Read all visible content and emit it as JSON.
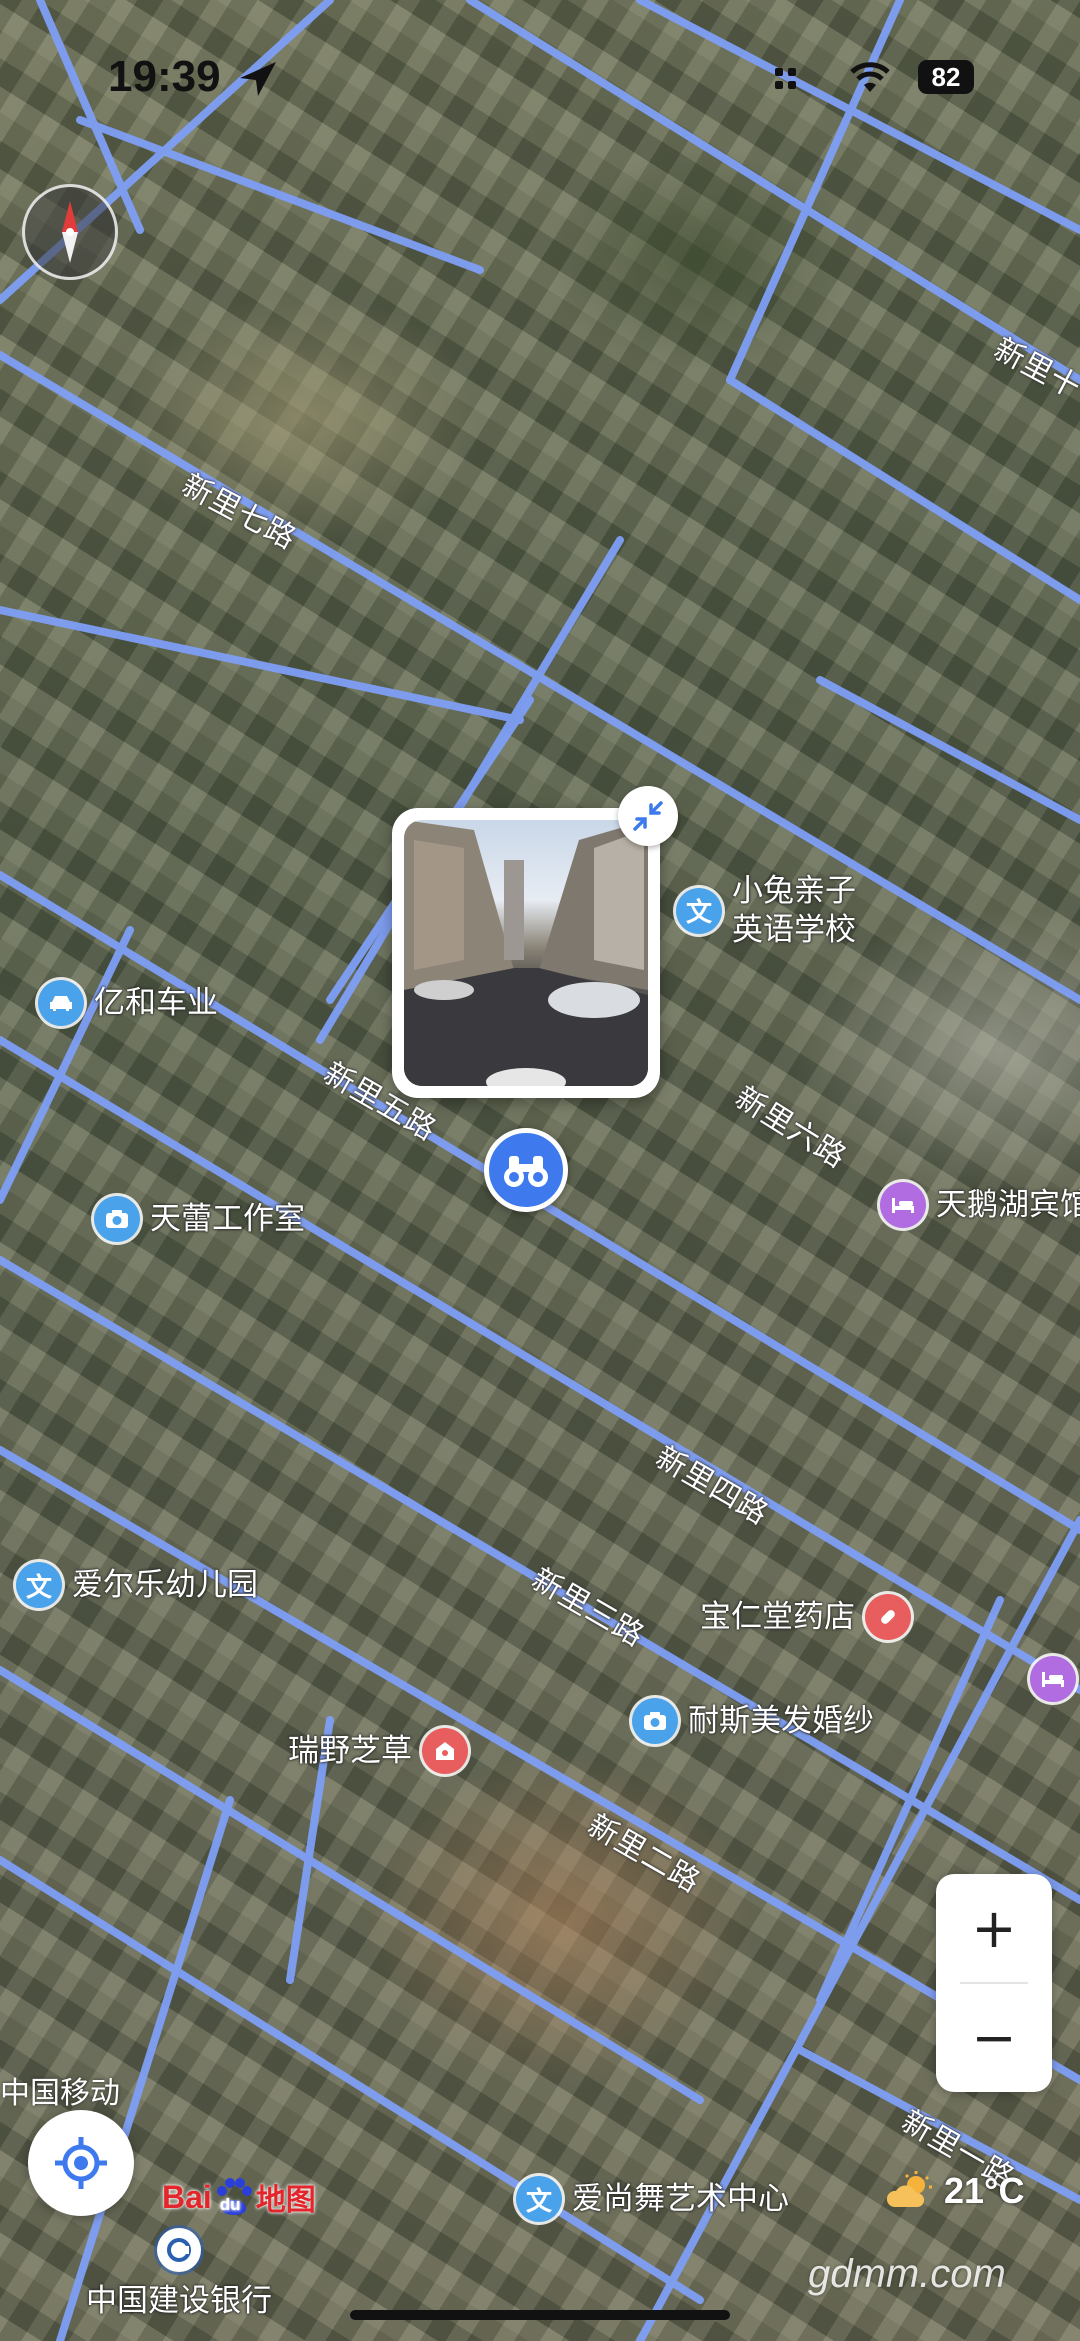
{
  "status_bar": {
    "time": "19:39",
    "battery": "82"
  },
  "roads": [
    {
      "label": "新里七路"
    },
    {
      "label": "新里五路"
    },
    {
      "label": "新里六路"
    },
    {
      "label": "新里四路"
    },
    {
      "label": "新里三路"
    },
    {
      "label": "新里二路"
    },
    {
      "label": "新里一路"
    },
    {
      "label": "新里十"
    }
  ],
  "pois": [
    {
      "name": "小兔亲子\n英语学校",
      "icon": "education-icon"
    },
    {
      "name": "亿和车业",
      "icon": "car-icon"
    },
    {
      "name": "天蕾工作室",
      "icon": "camera-icon"
    },
    {
      "name": "天鹅湖宾馆",
      "icon": "hotel-icon"
    },
    {
      "name": "爱尔乐幼儿园",
      "icon": "education-icon"
    },
    {
      "name": "宝仁堂药店",
      "icon": "pharmacy-icon"
    },
    {
      "name": "耐斯美发婚纱",
      "icon": "camera-icon"
    },
    {
      "name": "瑞野芝草",
      "icon": "shop-icon"
    },
    {
      "name": "爱尚舞艺术中心",
      "icon": "education-icon"
    },
    {
      "name": "中国建设银行",
      "icon": "bank-icon"
    }
  ],
  "controls": {
    "zoom_in": "+",
    "zoom_out": "−"
  },
  "carrier": "中国移动",
  "logo": {
    "bai": "Bai",
    "du": "du",
    "ditu": "地图"
  },
  "weather": {
    "temp": "21°C",
    "icon": "partly-cloudy-icon"
  },
  "watermark": "gdmm.com",
  "colors": {
    "road": "#7f9ff5",
    "accent": "#3e79ee"
  }
}
